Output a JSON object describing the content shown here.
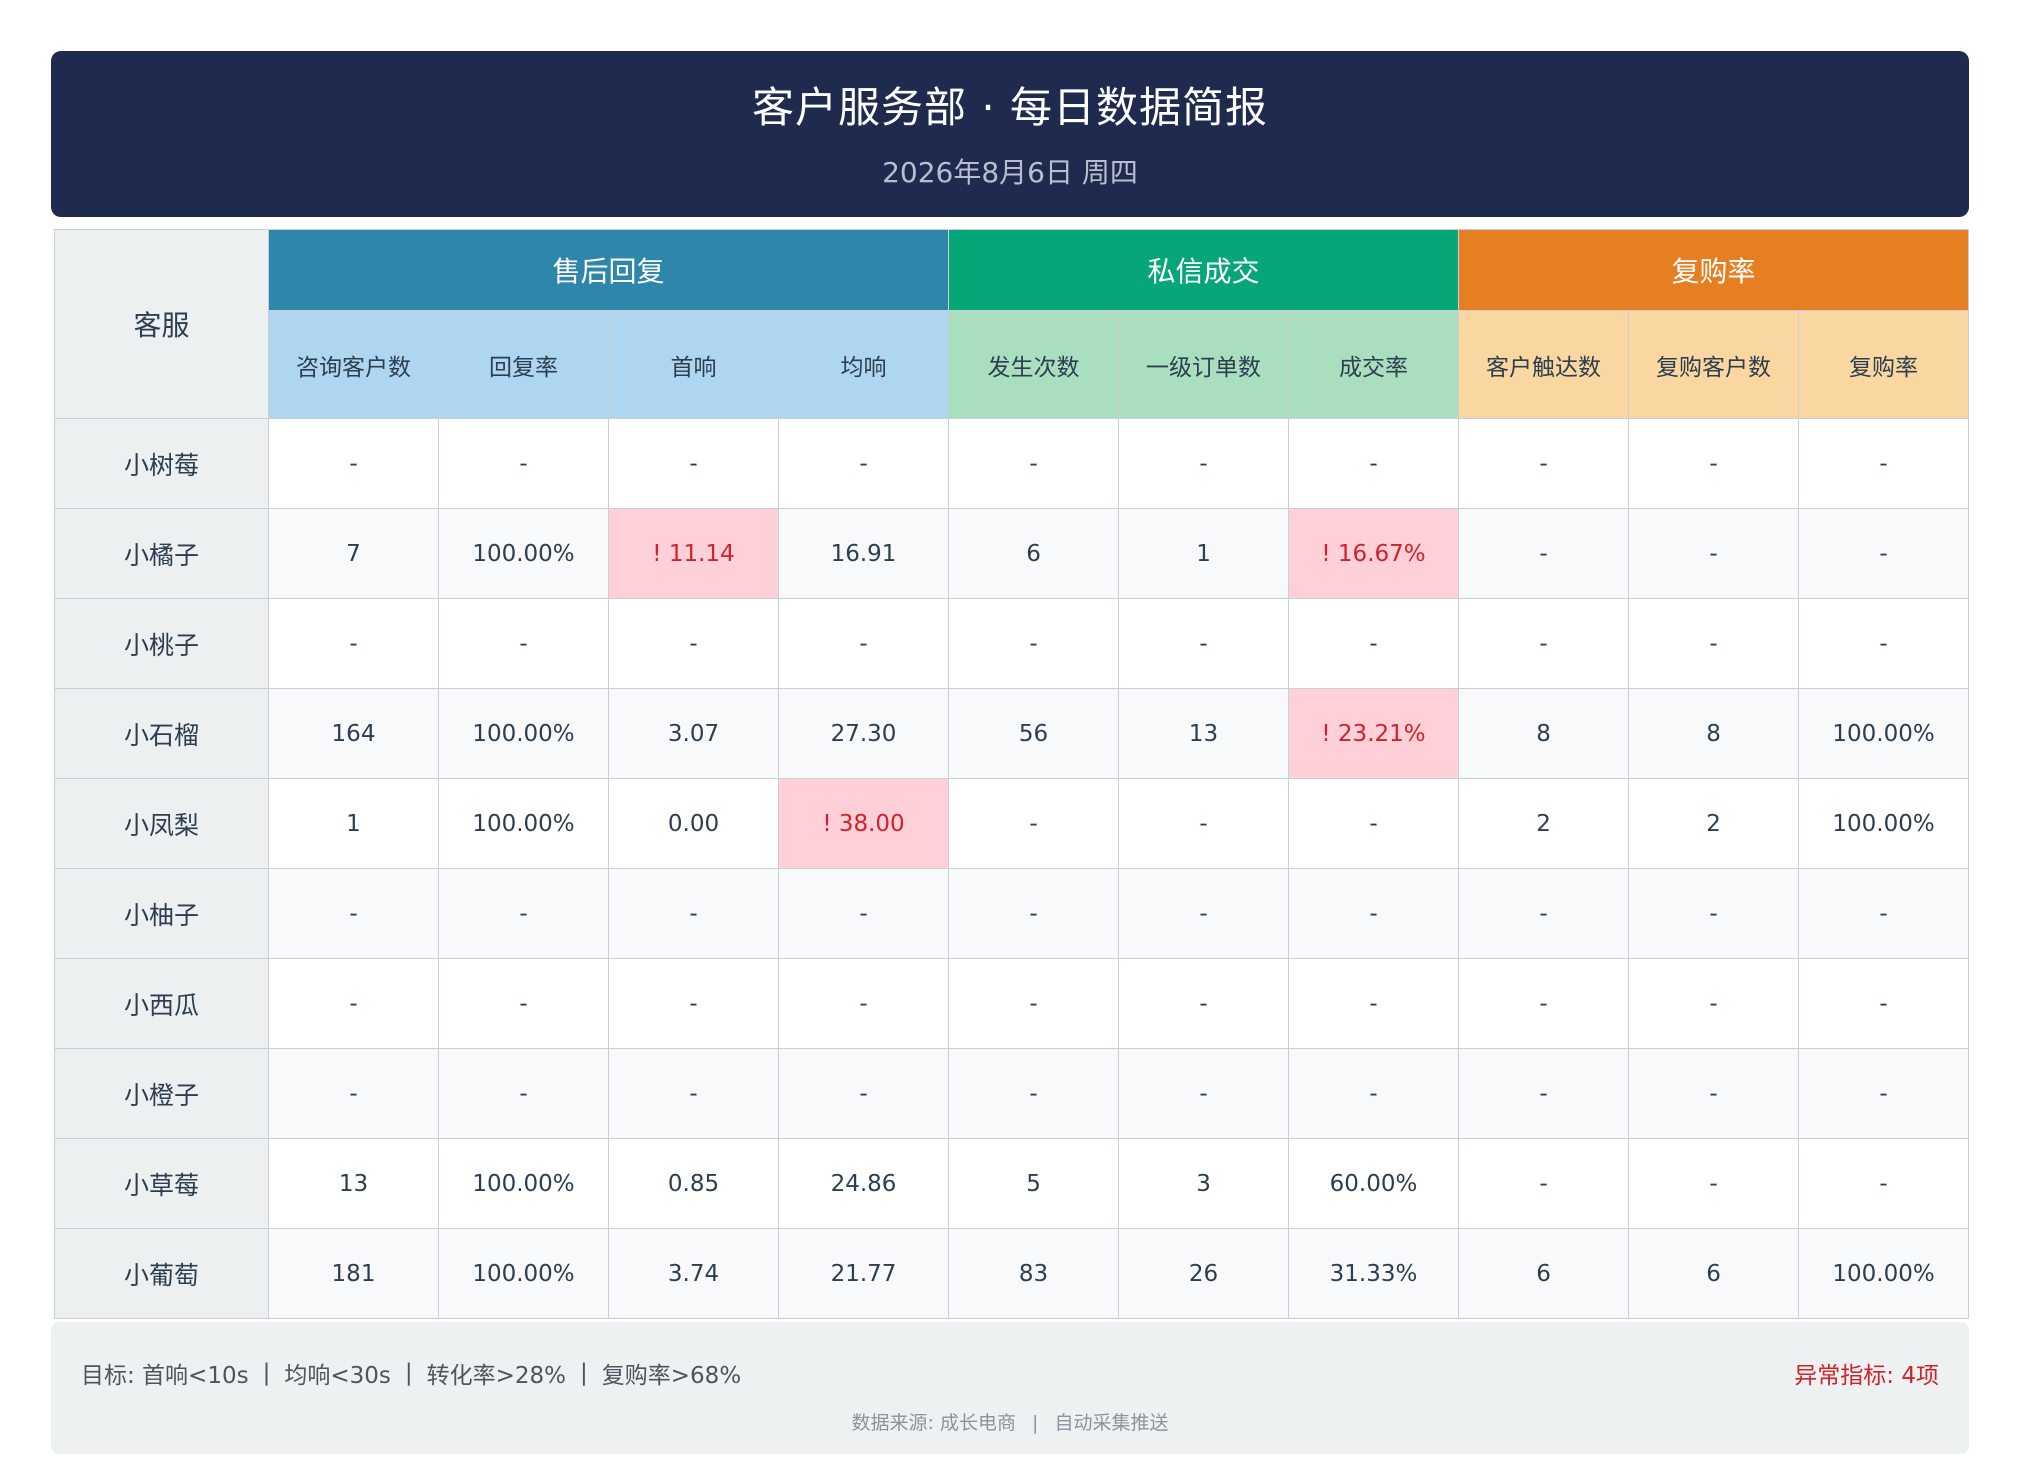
{
  "header": {
    "title": "客户服务部 · 每日数据简报",
    "date": "2026年8月6日 周四"
  },
  "table": {
    "agent_header": "客服",
    "groups": [
      {
        "label": "售后回复",
        "color": "#2e86ab"
      },
      {
        "label": "私信成交",
        "color": "#07a679"
      },
      {
        "label": "复购率",
        "color": "#e67e22"
      }
    ],
    "columns": [
      "咨询客户数",
      "回复率",
      "首响",
      "均响",
      "发生次数",
      "一级订单数",
      "成交率",
      "客户触达数",
      "复购客户数",
      "复购率"
    ],
    "rows": [
      {
        "agent": "小树莓",
        "values": [
          "-",
          "-",
          "-",
          "-",
          "-",
          "-",
          "-",
          "-",
          "-",
          "-"
        ]
      },
      {
        "agent": "小橘子",
        "values": [
          "7",
          "100.00%",
          "! 11.14",
          "16.91",
          "6",
          "1",
          "! 16.67%",
          "-",
          "-",
          "-"
        ]
      },
      {
        "agent": "小桃子",
        "values": [
          "-",
          "-",
          "-",
          "-",
          "-",
          "-",
          "-",
          "-",
          "-",
          "-"
        ]
      },
      {
        "agent": "小石榴",
        "values": [
          "164",
          "100.00%",
          "3.07",
          "27.30",
          "56",
          "13",
          "! 23.21%",
          "8",
          "8",
          "100.00%"
        ]
      },
      {
        "agent": "小凤梨",
        "values": [
          "1",
          "100.00%",
          "0.00",
          "! 38.00",
          "-",
          "-",
          "-",
          "2",
          "2",
          "100.00%"
        ]
      },
      {
        "agent": "小柚子",
        "values": [
          "-",
          "-",
          "-",
          "-",
          "-",
          "-",
          "-",
          "-",
          "-",
          "-"
        ]
      },
      {
        "agent": "小西瓜",
        "values": [
          "-",
          "-",
          "-",
          "-",
          "-",
          "-",
          "-",
          "-",
          "-",
          "-"
        ]
      },
      {
        "agent": "小橙子",
        "values": [
          "-",
          "-",
          "-",
          "-",
          "-",
          "-",
          "-",
          "-",
          "-",
          "-"
        ]
      },
      {
        "agent": "小草莓",
        "values": [
          "13",
          "100.00%",
          "0.85",
          "24.86",
          "5",
          "3",
          "60.00%",
          "-",
          "-",
          "-"
        ]
      },
      {
        "agent": "小葡萄",
        "values": [
          "181",
          "100.00%",
          "3.74",
          "21.77",
          "83",
          "26",
          "31.33%",
          "6",
          "6",
          "100.00%"
        ]
      }
    ]
  },
  "footer": {
    "targets": [
      "目标: 首响<10s",
      "均响<30s",
      "转化率>28%",
      "复购率>68%"
    ],
    "alert": "异常指标: 4项",
    "source": [
      "数据来源: 成长电商",
      "自动采集推送"
    ]
  },
  "colors": {
    "banner": "#1e2a4e",
    "alert_bg": "#ffd0d7",
    "alert_text": "#d0222a"
  }
}
